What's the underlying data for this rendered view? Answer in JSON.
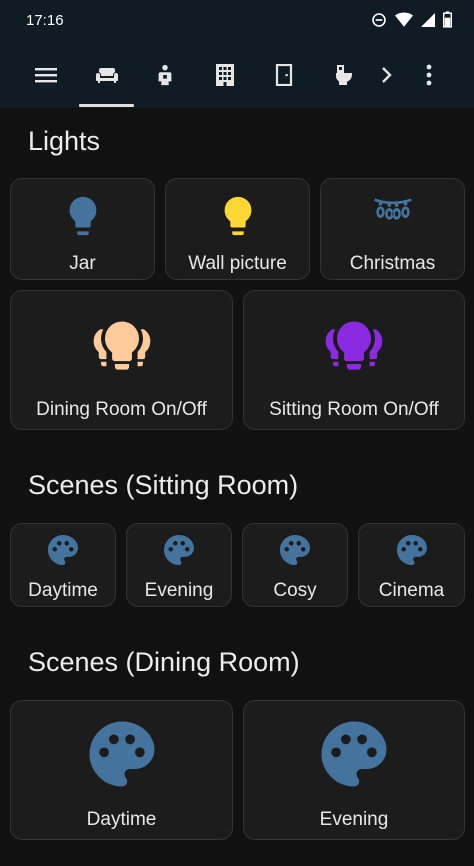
{
  "status": {
    "time": "17:16"
  },
  "nav": {
    "tabs": [
      {
        "icon": "menu-icon"
      },
      {
        "icon": "sofa-icon",
        "active": true
      },
      {
        "icon": "person-icon"
      },
      {
        "icon": "office-building-icon"
      },
      {
        "icon": "door-icon"
      },
      {
        "icon": "toilet-icon"
      },
      {
        "icon": "chevron-right-icon"
      },
      {
        "icon": "more-vertical-icon"
      }
    ]
  },
  "lights": {
    "title": "Lights",
    "jar": {
      "label": "Jar",
      "icon": "lightbulb-icon",
      "color": "#44739e"
    },
    "wall_picture": {
      "label": "Wall picture",
      "icon": "lightbulb-icon",
      "color": "#fdd835"
    },
    "christmas": {
      "label": "Christmas",
      "icon": "string-lights-icon",
      "color": "#44739e"
    },
    "dining_room": {
      "label": "Dining Room On/Off",
      "icon": "lightbulb-group-icon",
      "color": "#ffcb9a"
    },
    "sitting_room": {
      "label": "Sitting Room On/Off",
      "icon": "lightbulb-group-icon",
      "color": "#8a2be2"
    }
  },
  "scenes_sitting": {
    "title": "Scenes (Sitting Room)",
    "items": [
      {
        "label": "Daytime",
        "icon": "palette-icon"
      },
      {
        "label": "Evening",
        "icon": "palette-icon"
      },
      {
        "label": "Cosy",
        "icon": "palette-icon"
      },
      {
        "label": "Cinema",
        "icon": "palette-icon"
      }
    ]
  },
  "scenes_dining": {
    "title": "Scenes (Dining Room)",
    "items": [
      {
        "label": "Daytime",
        "icon": "palette-icon"
      },
      {
        "label": "Evening",
        "icon": "palette-icon"
      }
    ]
  },
  "colors": {
    "scene_icon": "#44739e",
    "background": "#111111",
    "card": "#1c1c1c",
    "app_bar": "#101c24"
  }
}
